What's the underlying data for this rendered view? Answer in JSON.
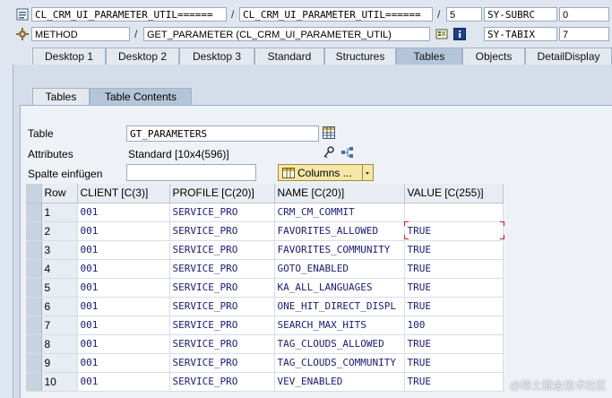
{
  "header": {
    "row1": {
      "field1": "CL_CRM_UI_PARAMETER_UTIL======",
      "field2": "CL_CRM_UI_PARAMETER_UTIL======",
      "line": "5",
      "sysvar": "SY-SUBRC",
      "sysvalue": "0"
    },
    "row2": {
      "field1": "METHOD",
      "field2": "GET_PARAMETER (CL_CRM_UI_PARAMETER_UTIL)",
      "sysvar": "SY-TABIX",
      "sysvalue": "7"
    },
    "slash": "/"
  },
  "tabs": [
    "Desktop 1",
    "Desktop 2",
    "Desktop 3",
    "Standard",
    "Structures",
    "Tables",
    "Objects",
    "DetailDisplay"
  ],
  "subtabs": [
    "Tables",
    "Table Contents"
  ],
  "form": {
    "table_label": "Table",
    "table_value": "GT_PARAMETERS",
    "attributes_label": "Attributes",
    "attributes_value": "Standard [10x4(596)]",
    "spalte_label": "Spalte einfügen",
    "spalte_value": "",
    "columns_button": "Columns ..."
  },
  "grid": {
    "headers": [
      "Row",
      "CLIENT [C(3)]",
      "PROFILE [C(20)]",
      "NAME [C(20)]",
      "VALUE [C(255)]"
    ],
    "rows": [
      [
        "1",
        "001",
        "SERVICE_PRO",
        "CRM_CM_COMMIT",
        ""
      ],
      [
        "2",
        "001",
        "SERVICE_PRO",
        "FAVORITES_ALLOWED",
        "TRUE"
      ],
      [
        "3",
        "001",
        "SERVICE_PRO",
        "FAVORITES_COMMUNITY",
        "TRUE"
      ],
      [
        "4",
        "001",
        "SERVICE_PRO",
        "GOTO_ENABLED",
        "TRUE"
      ],
      [
        "5",
        "001",
        "SERVICE_PRO",
        "KA_ALL_LANGUAGES",
        "TRUE"
      ],
      [
        "6",
        "001",
        "SERVICE_PRO",
        "ONE_HIT_DIRECT_DISPL",
        "TRUE"
      ],
      [
        "7",
        "001",
        "SERVICE_PRO",
        "SEARCH_MAX_HITS",
        "100"
      ],
      [
        "8",
        "001",
        "SERVICE_PRO",
        "TAG_CLOUDS_ALLOWED",
        "TRUE"
      ],
      [
        "9",
        "001",
        "SERVICE_PRO",
        "TAG_CLOUDS_COMMUNITY",
        "TRUE"
      ],
      [
        "10",
        "001",
        "SERVICE_PRO",
        "VEV_ENABLED",
        "TRUE"
      ]
    ]
  },
  "watermark": "@稀土掘金技术社区"
}
